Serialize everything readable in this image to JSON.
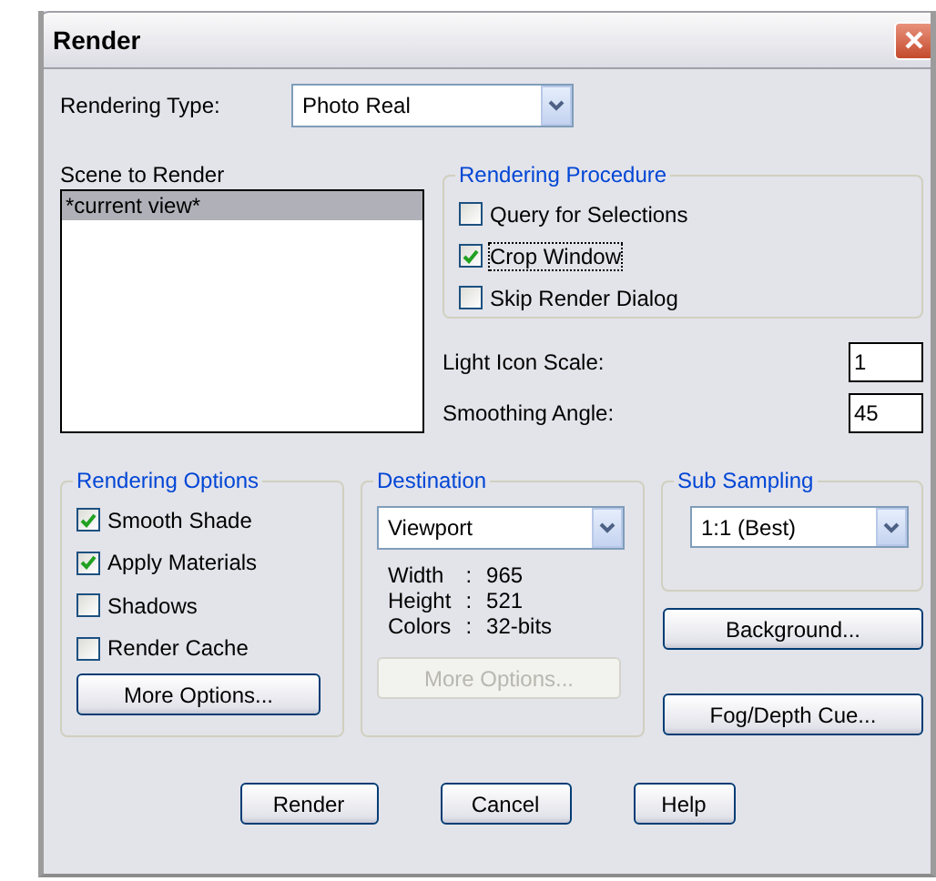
{
  "window": {
    "title": "Render"
  },
  "rendering_type": {
    "label": "Rendering Type:",
    "value": "Photo Real"
  },
  "scene": {
    "label": "Scene to Render",
    "items": [
      {
        "label": "*current view*",
        "selected": true
      }
    ]
  },
  "rendering_procedure": {
    "title": "Rendering Procedure",
    "options": [
      {
        "label": "Query for Selections",
        "checked": false,
        "focused": false
      },
      {
        "label": "Crop Window",
        "checked": true,
        "focused": true
      },
      {
        "label": "Skip Render Dialog",
        "checked": false,
        "focused": false
      }
    ]
  },
  "fields": [
    {
      "label": "Light Icon Scale:",
      "value": "1"
    },
    {
      "label": "Smoothing Angle:",
      "value": "45"
    }
  ],
  "rendering_options": {
    "title": "Rendering Options",
    "options": [
      {
        "label": "Smooth Shade",
        "checked": true
      },
      {
        "label": "Apply Materials",
        "checked": true
      },
      {
        "label": "Shadows",
        "checked": false
      },
      {
        "label": "Render Cache",
        "checked": false
      }
    ],
    "button": {
      "label": "More Options...",
      "disabled": false
    }
  },
  "destination": {
    "title": "Destination",
    "value": "Viewport",
    "info": [
      {
        "label": "Width",
        "sep": ":",
        "value": "965"
      },
      {
        "label": "Height",
        "sep": ":",
        "value": "521"
      },
      {
        "label": "Colors",
        "sep": ":",
        "value": "32-bits"
      }
    ],
    "button": {
      "label": "More Options...",
      "disabled": true
    }
  },
  "sub_sampling": {
    "title": "Sub Sampling",
    "value": "1:1 (Best)"
  },
  "side_buttons": [
    "Background...",
    "Fog/Depth Cue..."
  ],
  "buttons": [
    "Render",
    "Cancel",
    "Help"
  ]
}
